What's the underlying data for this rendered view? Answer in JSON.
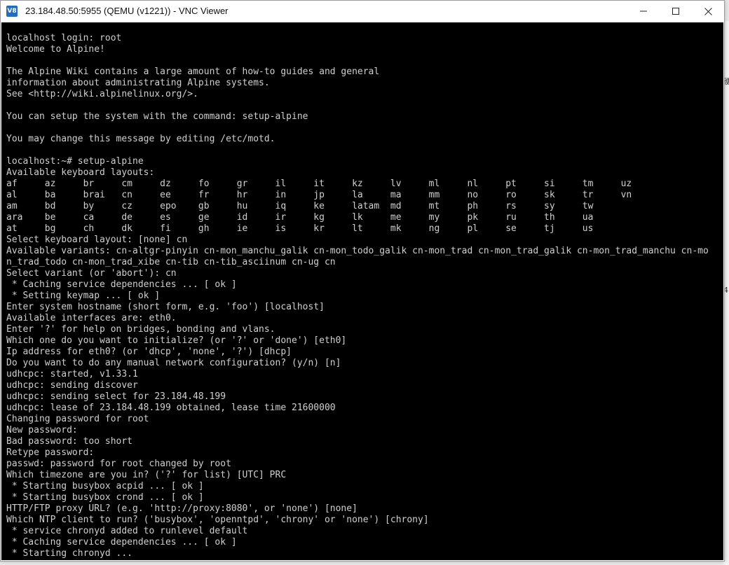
{
  "window": {
    "title": "23.184.48.50:5955 (QEMU (v1221)) - VNC Viewer",
    "app_icon": "V8",
    "icons": [
      "vnc-app-icon",
      "minimize-icon",
      "maximize-icon",
      "close-icon"
    ]
  },
  "desktop": {
    "right_marks": [
      "绠",
      "4"
    ]
  },
  "terminal": {
    "text_color": "#cfcfcf",
    "background": "#000000",
    "lines": [
      "localhost login: root",
      "Welcome to Alpine!",
      "",
      "The Alpine Wiki contains a large amount of how-to guides and general",
      "information about administrating Alpine systems.",
      "See <http://wiki.alpinelinux.org/>.",
      "",
      "You can setup the system with the command: setup-alpine",
      "",
      "You may change this message by editing /etc/motd.",
      "",
      "localhost:~# setup-alpine",
      "Available keyboard layouts:",
      "af     az     br     cm     dz     fo     gr     il     it     kz     lv     ml     nl     pt     si     tm     uz",
      "al     ba     brai   cn     ee     fr     hr     in     jp     la     ma     mm     no     ro     sk     tr     vn",
      "am     bd     by     cz     epo    gb     hu     iq     ke     latam  md     mt     ph     rs     sy     tw",
      "ara    be     ca     de     es     ge     id     ir     kg     lk     me     my     pk     ru     th     ua",
      "at     bg     ch     dk     fi     gh     ie     is     kr     lt     mk     ng     pl     se     tj     us",
      "Select keyboard layout: [none] cn",
      "Available variants: cn-altgr-pinyin cn-mon_manchu_galik cn-mon_todo_galik cn-mon_trad cn-mon_trad_galik cn-mon_trad_manchu cn-mo",
      "n_trad_todo cn-mon_trad_xibe cn-tib cn-tib_asciinum cn-ug cn",
      "Select variant (or 'abort'): cn",
      " * Caching service dependencies ... [ ok ]",
      " * Setting keymap ... [ ok ]",
      "Enter system hostname (short form, e.g. 'foo') [localhost]",
      "Available interfaces are: eth0.",
      "Enter '?' for help on bridges, bonding and vlans.",
      "Which one do you want to initialize? (or '?' or 'done') [eth0]",
      "Ip address for eth0? (or 'dhcp', 'none', '?') [dhcp]",
      "Do you want to do any manual network configuration? (y/n) [n]",
      "udhcpc: started, v1.33.1",
      "udhcpc: sending discover",
      "udhcpc: sending select for 23.184.48.199",
      "udhcpc: lease of 23.184.48.199 obtained, lease time 21600000",
      "Changing password for root",
      "New password:",
      "Bad password: too short",
      "Retype password:",
      "passwd: password for root changed by root",
      "Which timezone are you in? ('?' for list) [UTC] PRC",
      " * Starting busybox acpid ... [ ok ]",
      " * Starting busybox crond ... [ ok ]",
      "HTTP/FTP proxy URL? (e.g. 'http://proxy:8080', or 'none') [none]",
      "Which NTP client to run? ('busybox', 'openntpd', 'chrony' or 'none') [chrony]",
      " * service chronyd added to runlevel default",
      " * Caching service dependencies ... [ ok ]",
      " * Starting chronyd ..."
    ]
  }
}
